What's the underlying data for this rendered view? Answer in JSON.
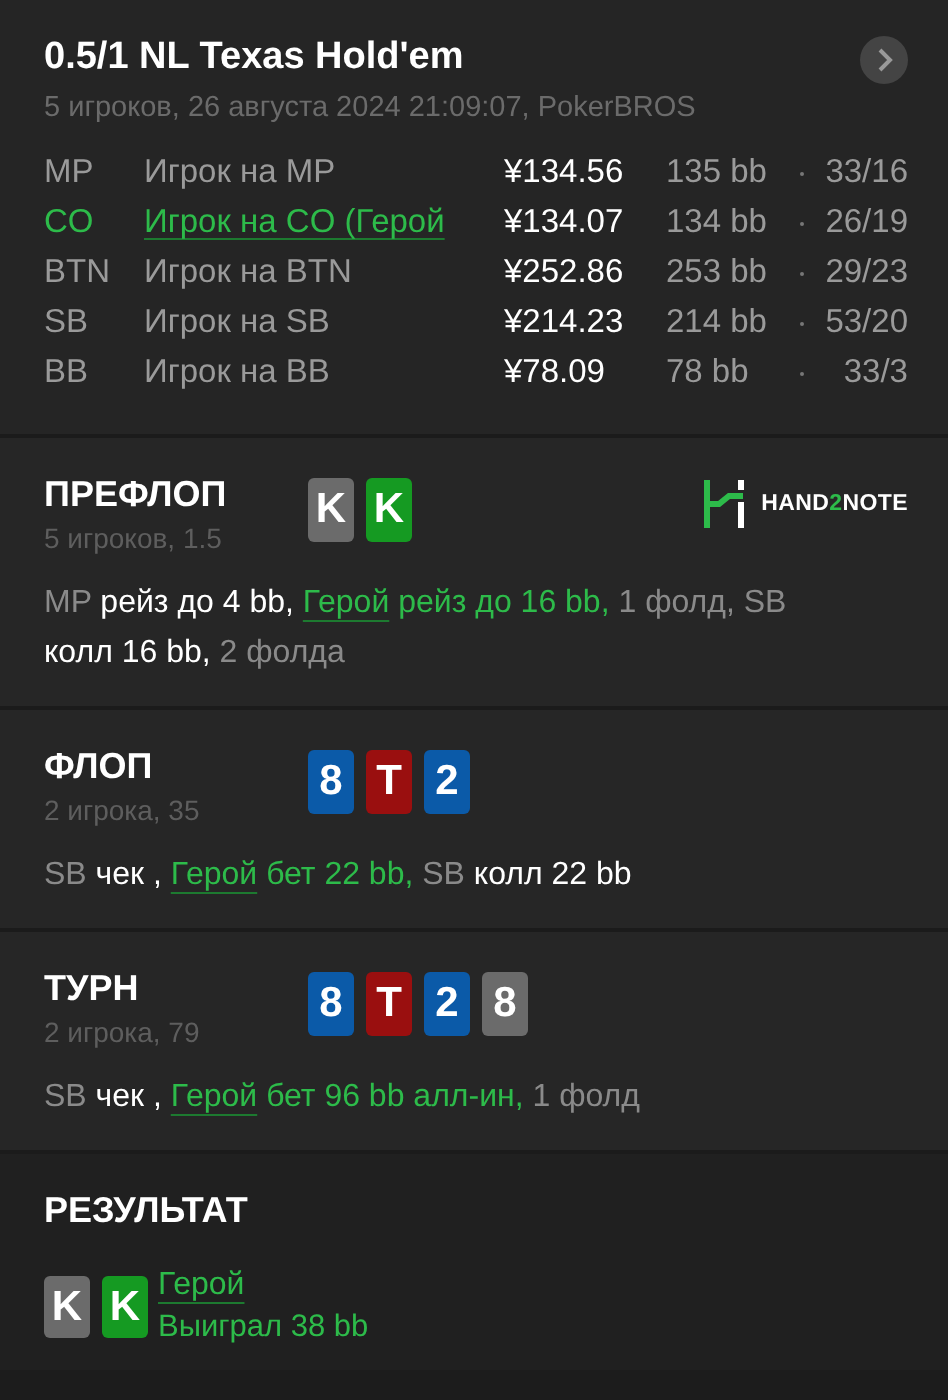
{
  "header": {
    "title": "0.5/1 NL Texas Hold'em",
    "subtitle": "5 игроков, 26 августа 2024 21:09:07, PokerBROS"
  },
  "players": [
    {
      "position": "MP",
      "name": "Игрок на MP",
      "stack": "¥134.56",
      "bb": "135 bb",
      "stats": "33/16",
      "hero": false
    },
    {
      "position": "CO",
      "name": "Игрок на CO (Герой",
      "stack": "¥134.07",
      "bb": "134 bb",
      "stats": "26/19",
      "hero": true
    },
    {
      "position": "BTN",
      "name": "Игрок на BTN",
      "stack": "¥252.86",
      "bb": "253 bb",
      "stats": "29/23",
      "hero": false
    },
    {
      "position": "SB",
      "name": "Игрок на SB",
      "stack": "¥214.23",
      "bb": "214 bb",
      "stats": "53/20",
      "hero": false
    },
    {
      "position": "BB",
      "name": "Игрок на BB",
      "stack": "¥78.09",
      "bb": "78 bb",
      "stats": "33/3",
      "hero": false
    }
  ],
  "streets": [
    {
      "title": "ПРЕФЛОП",
      "subtitle": "5 игроков, 1.5",
      "logo": [
        "HAND",
        "2",
        "NOTE"
      ],
      "cards": [
        {
          "rank": "K",
          "color": "#6b6b6b"
        },
        {
          "rank": "K",
          "color": "#159a22"
        }
      ],
      "actions": [
        {
          "kind": "seat",
          "text": "MP"
        },
        {
          "kind": "action",
          "text": "рейз до 4 bb,"
        },
        {
          "kind": "hero",
          "text": "Герой"
        },
        {
          "kind": "hero_action",
          "text": "рейз до 16 bb,"
        },
        {
          "kind": "fold",
          "text": "1 фолд, SB"
        },
        {
          "kind": "action",
          "text": "колл 16 bb,"
        },
        {
          "kind": "fold",
          "text": "2 фолда"
        }
      ]
    },
    {
      "title": "ФЛОП",
      "subtitle": "2 игрока, 35",
      "cards": [
        {
          "rank": "8",
          "color": "#0b5aa8"
        },
        {
          "rank": "T",
          "color": "#9a0f0f"
        },
        {
          "rank": "2",
          "color": "#0b5aa8"
        }
      ],
      "actions": [
        {
          "kind": "seat",
          "text": "SB"
        },
        {
          "kind": "action",
          "text": "чек ,"
        },
        {
          "kind": "hero",
          "text": "Герой"
        },
        {
          "kind": "hero_action",
          "text": "бет 22 bb,"
        },
        {
          "kind": "seat",
          "text": "SB"
        },
        {
          "kind": "action",
          "text": "колл 22 bb"
        }
      ]
    },
    {
      "title": "ТУРН",
      "subtitle": "2 игрока, 79",
      "cards": [
        {
          "rank": "8",
          "color": "#0b5aa8"
        },
        {
          "rank": "T",
          "color": "#9a0f0f"
        },
        {
          "rank": "2",
          "color": "#0b5aa8"
        },
        {
          "rank": "8",
          "color": "#6b6b6b"
        }
      ],
      "actions": [
        {
          "kind": "seat",
          "text": "SB"
        },
        {
          "kind": "action",
          "text": "чек ,"
        },
        {
          "kind": "hero",
          "text": "Герой"
        },
        {
          "kind": "hero_action",
          "text": "бет 96 bb алл-ин,"
        },
        {
          "kind": "fold",
          "text": "1 фолд"
        }
      ]
    }
  ],
  "result": {
    "title": "РЕЗУЛЬТАТ",
    "cards": [
      {
        "rank": "K",
        "color": "#6b6b6b"
      },
      {
        "rank": "K",
        "color": "#159a22"
      }
    ],
    "winner": "Герой",
    "outcome": "Выиграл 38 bb"
  }
}
